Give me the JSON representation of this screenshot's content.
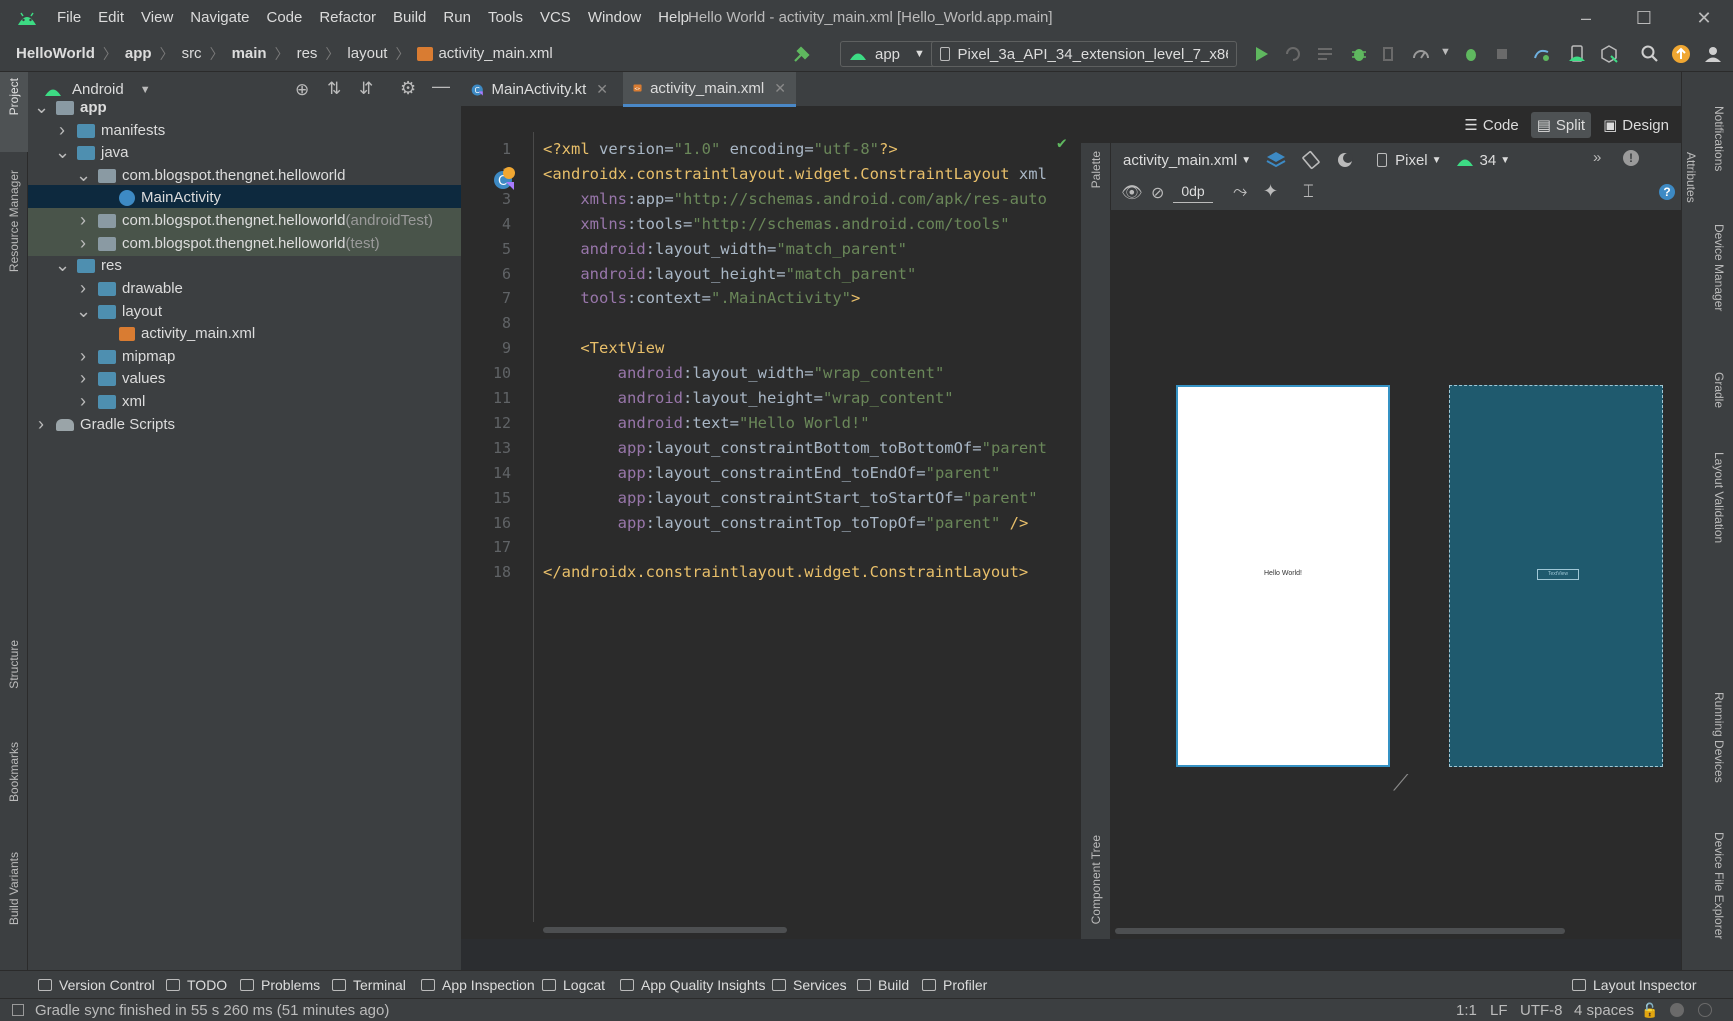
{
  "menu": [
    "File",
    "Edit",
    "View",
    "Navigate",
    "Code",
    "Refactor",
    "Build",
    "Run",
    "Tools",
    "VCS",
    "Window",
    "Help"
  ],
  "window_title": "Hello World - activity_main.xml [Hello_World.app.main]",
  "breadcrumbs": [
    "HelloWorld",
    "app",
    "src",
    "main",
    "res",
    "layout",
    "activity_main.xml"
  ],
  "toolbar": {
    "run_config": "app",
    "device": "Pixel_3a_API_34_extension_level_7_x86..."
  },
  "project_panel": {
    "view_mode": "Android",
    "tree": [
      {
        "label": "app",
        "suffix": "",
        "level": 0,
        "chev": "v",
        "icon": "module"
      },
      {
        "label": "manifests",
        "suffix": "",
        "level": 1,
        "chev": ">",
        "icon": "folder"
      },
      {
        "label": "java",
        "suffix": "",
        "level": 1,
        "chev": "v",
        "icon": "folder"
      },
      {
        "label": "com.blogspot.thengnet.helloworld",
        "suffix": "",
        "level": 2,
        "chev": "v",
        "icon": "package"
      },
      {
        "label": "MainActivity",
        "suffix": "",
        "level": 3,
        "chev": "",
        "icon": "kotlin"
      },
      {
        "label": "com.blogspot.thengnet.helloworld",
        "suffix": " (androidTest)",
        "level": 2,
        "chev": ">",
        "icon": "package"
      },
      {
        "label": "com.blogspot.thengnet.helloworld",
        "suffix": " (test)",
        "level": 2,
        "chev": ">",
        "icon": "package"
      },
      {
        "label": "res",
        "suffix": "",
        "level": 1,
        "chev": "v",
        "icon": "folder"
      },
      {
        "label": "drawable",
        "suffix": "",
        "level": 2,
        "chev": ">",
        "icon": "folder"
      },
      {
        "label": "layout",
        "suffix": "",
        "level": 2,
        "chev": "v",
        "icon": "folder"
      },
      {
        "label": "activity_main.xml",
        "suffix": "",
        "level": 3,
        "chev": "",
        "icon": "xml"
      },
      {
        "label": "mipmap",
        "suffix": "",
        "level": 2,
        "chev": ">",
        "icon": "folder"
      },
      {
        "label": "values",
        "suffix": "",
        "level": 2,
        "chev": ">",
        "icon": "folder"
      },
      {
        "label": "xml",
        "suffix": "",
        "level": 2,
        "chev": ">",
        "icon": "folder"
      },
      {
        "label": "Gradle Scripts",
        "suffix": "",
        "level": 0,
        "chev": ">",
        "icon": "gradle"
      }
    ]
  },
  "tabs": [
    {
      "label": "MainActivity.kt",
      "active": false
    },
    {
      "label": "activity_main.xml",
      "active": true
    }
  ],
  "code_lines": [
    "<?xml version=\"1.0\" encoding=\"utf-8\"?>",
    "<androidx.constraintlayout.widget.ConstraintLayout xml",
    "    xmlns:app=\"http://schemas.android.com/apk/res-auto",
    "    xmlns:tools=\"http://schemas.android.com/tools\"",
    "    android:layout_width=\"match_parent\"",
    "    android:layout_height=\"match_parent\"",
    "    tools:context=\".MainActivity\">",
    "",
    "    <TextView",
    "        android:layout_width=\"wrap_content\"",
    "        android:layout_height=\"wrap_content\"",
    "        android:text=\"Hello World!\"",
    "        app:layout_constraintBottom_toBottomOf=\"parent",
    "        app:layout_constraintEnd_toEndOf=\"parent\"",
    "        app:layout_constraintStart_toStartOf=\"parent\"",
    "        app:layout_constraintTop_toTopOf=\"parent\" />",
    "",
    "</androidx.constraintlayout.widget.ConstraintLayout>"
  ],
  "view_modes": [
    "Code",
    "Split",
    "Design"
  ],
  "design": {
    "file": "activity_main.xml",
    "device": "Pixel",
    "api": "34",
    "margin": "0dp",
    "preview_text": "Hello World!",
    "blueprint_text": "TextView"
  },
  "side_labels": {
    "left": [
      "Project",
      "Resource Manager",
      "Structure",
      "Bookmarks",
      "Build Variants"
    ],
    "right": [
      "Notifications",
      "Device Manager",
      "Gradle",
      "Layout Validation",
      "Running Devices",
      "Device File Explorer"
    ],
    "attributes": "Attributes",
    "palette": "Palette",
    "component_tree": "Component Tree"
  },
  "bottom_tools": [
    "Version Control",
    "TODO",
    "Problems",
    "Terminal",
    "App Inspection",
    "Logcat",
    "App Quality Insights",
    "Services",
    "Build",
    "Profiler"
  ],
  "layout_inspector": "Layout Inspector",
  "status": {
    "message": "Gradle sync finished in 55 s 260 ms (51 minutes ago)",
    "position": "1:1",
    "line_sep": "LF",
    "encoding": "UTF-8",
    "indent": "4 spaces"
  },
  "colors": {
    "accent": "#4a88c7",
    "android_green": "#3ddc84",
    "blueprint": "#1f5a6e"
  }
}
